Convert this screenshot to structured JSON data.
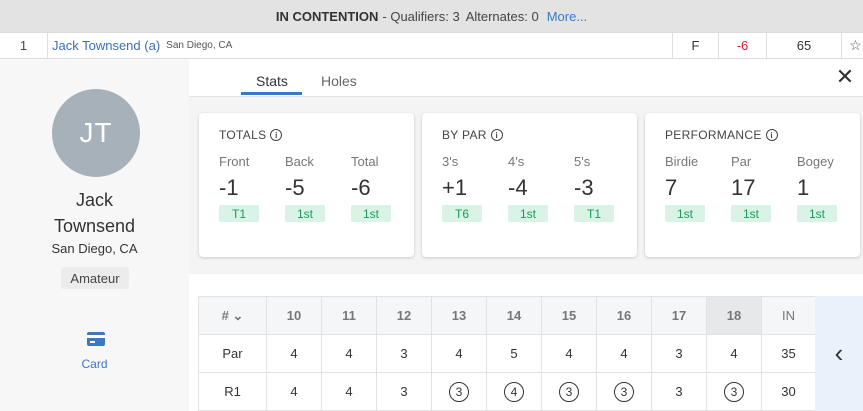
{
  "banner": {
    "title": "IN CONTENTION",
    "qualifiers": "- Qualifiers: 3",
    "alternates": "Alternates: 0",
    "more": "More..."
  },
  "player_row": {
    "position": "1",
    "name": "Jack Townsend (a)",
    "location": "San Diego, CA",
    "thru": "F",
    "to_par": "-6",
    "score": "65",
    "favorite_icon": "star-outline-icon"
  },
  "profile": {
    "initials": "JT",
    "first_name": "Jack",
    "last_name": "Townsend",
    "location": "San Diego, CA",
    "status": "Amateur",
    "card_label": "Card",
    "card_icon": "scorecard-icon"
  },
  "tabs": [
    {
      "label": "Stats",
      "active": true
    },
    {
      "label": "Holes",
      "active": false
    }
  ],
  "close_icon": "close-icon",
  "panels": [
    {
      "title": "TOTALS",
      "items": [
        {
          "label": "Front",
          "value": "-1",
          "rank": "T1"
        },
        {
          "label": "Back",
          "value": "-5",
          "rank": "1st"
        },
        {
          "label": "Total",
          "value": "-6",
          "rank": "1st"
        }
      ]
    },
    {
      "title": "BY PAR",
      "items": [
        {
          "label": "3's",
          "value": "+1",
          "rank": "T6"
        },
        {
          "label": "4's",
          "value": "-4",
          "rank": "1st"
        },
        {
          "label": "5's",
          "value": "-3",
          "rank": "T1"
        }
      ]
    },
    {
      "title": "PERFORMANCE",
      "items": [
        {
          "label": "Birdie",
          "value": "7",
          "rank": "1st"
        },
        {
          "label": "Par",
          "value": "17",
          "rank": "1st"
        },
        {
          "label": "Bogey",
          "value": "1",
          "rank": "1st"
        }
      ]
    }
  ],
  "scorecard": {
    "hole_header": "#",
    "holes": [
      "10",
      "11",
      "12",
      "13",
      "14",
      "15",
      "16",
      "17",
      "18"
    ],
    "total_header": "IN",
    "rows": [
      {
        "label": "Par",
        "values": [
          "4",
          "4",
          "3",
          "4",
          "5",
          "4",
          "4",
          "3",
          "4"
        ],
        "total": "35",
        "circled": [
          false,
          false,
          false,
          false,
          false,
          false,
          false,
          false,
          false
        ]
      },
      {
        "label": "R1",
        "values": [
          "4",
          "4",
          "3",
          "3",
          "4",
          "3",
          "3",
          "3",
          "3"
        ],
        "total": "30",
        "circled": [
          false,
          false,
          false,
          true,
          true,
          true,
          true,
          false,
          true
        ]
      }
    ],
    "highlight_hole": "18"
  },
  "colors": {
    "accent": "#3a78c6",
    "under_par": "#d0202d",
    "rank_bg": "#d9f3e6",
    "rank_text": "#1c9a5a"
  }
}
